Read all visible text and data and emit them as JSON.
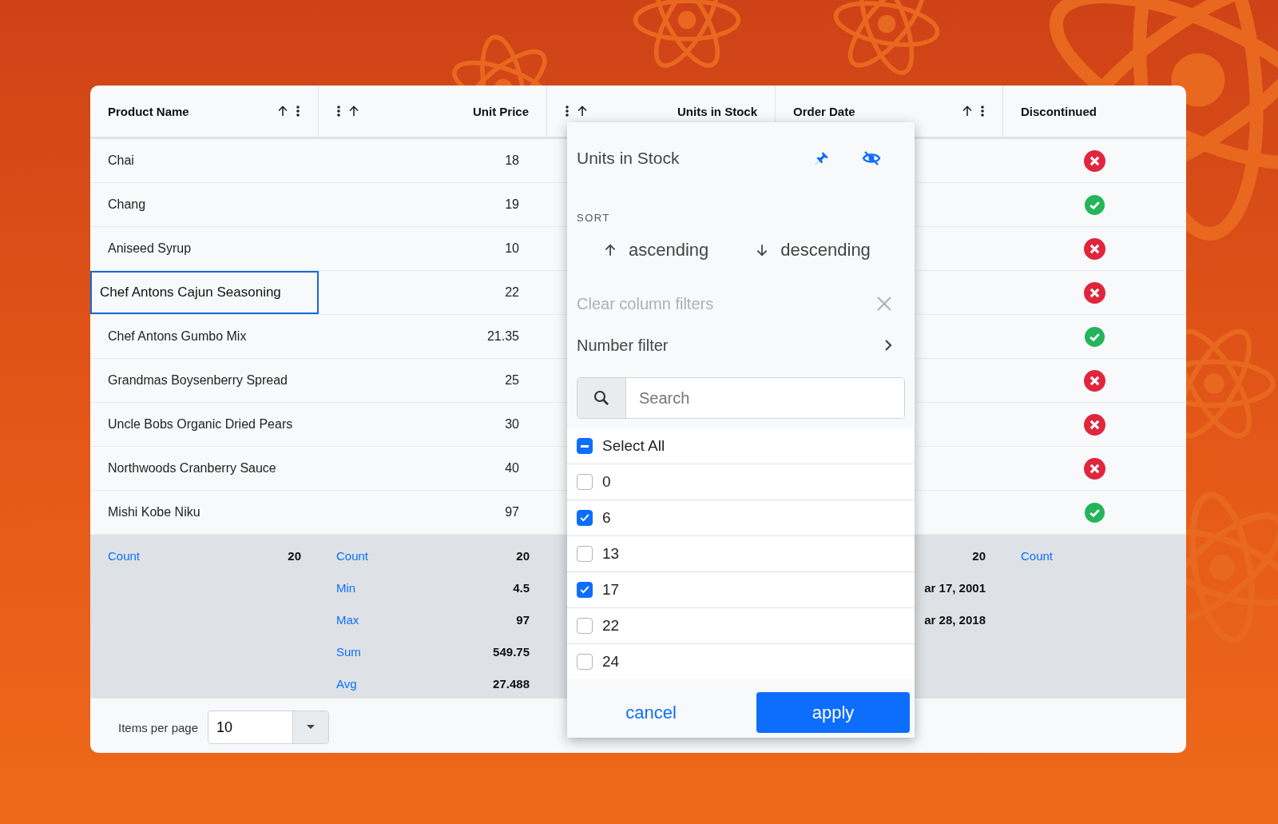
{
  "columns": [
    {
      "title": "Product Name",
      "kind": "text",
      "sorted": true,
      "menu": true
    },
    {
      "title": "Unit Price",
      "kind": "numeric",
      "sorted": true,
      "menu": true
    },
    {
      "title": "Units in Stock",
      "kind": "numeric",
      "sorted": true,
      "menu": true
    },
    {
      "title": "Order Date",
      "kind": "text",
      "sorted": true,
      "menu": true
    },
    {
      "title": "Discontinued",
      "kind": "text",
      "sorted": false,
      "menu": false
    }
  ],
  "rows": [
    {
      "name": "Chai",
      "price": "18",
      "discontinued": true,
      "focused": false
    },
    {
      "name": "Chang",
      "price": "19",
      "discontinued": false,
      "focused": false
    },
    {
      "name": "Aniseed Syrup",
      "price": "10",
      "discontinued": true,
      "focused": false
    },
    {
      "name": "Chef Antons Cajun Seasoning",
      "price": "22",
      "discontinued": true,
      "focused": true
    },
    {
      "name": "Chef Antons Gumbo Mix",
      "price": "21.35",
      "discontinued": false,
      "focused": false
    },
    {
      "name": "Grandmas Boysenberry Spread",
      "price": "25",
      "discontinued": true,
      "focused": false
    },
    {
      "name": "Uncle Bobs Organic Dried Pears",
      "price": "30",
      "discontinued": true,
      "focused": false
    },
    {
      "name": "Northwoods Cranberry Sauce",
      "price": "40",
      "discontinued": true,
      "focused": false
    },
    {
      "name": "Mishi Kobe Niku",
      "price": "97",
      "discontinued": false,
      "focused": false
    }
  ],
  "summary": {
    "product_name": [
      {
        "label": "Count",
        "value": "20"
      }
    ],
    "unit_price": [
      {
        "label": "Count",
        "value": "20"
      },
      {
        "label": "Min",
        "value": "4.5"
      },
      {
        "label": "Max",
        "value": "97"
      },
      {
        "label": "Sum",
        "value": "549.75"
      },
      {
        "label": "Avg",
        "value": "27.488"
      }
    ],
    "order_date": [
      {
        "value": "20"
      },
      {
        "value": "ar 17, 2001"
      },
      {
        "value": "ar 28, 2018"
      }
    ],
    "discontinued": [
      {
        "label": "Count"
      }
    ]
  },
  "pager": {
    "label": "Items per page",
    "value": "10"
  },
  "column_menu": {
    "title": "Units in Stock",
    "sort_label": "SORT",
    "sort_options": [
      {
        "label": "ascending",
        "kind": "up"
      },
      {
        "label": "descending",
        "kind": "down"
      }
    ],
    "clear_filters": {
      "label": "Clear column filters",
      "disabled": true
    },
    "number_filter": "Number filter",
    "search": {
      "placeholder": "Search"
    },
    "select_all": {
      "label": "Select All",
      "indeterminate": true
    },
    "values": [
      {
        "label": "0",
        "checked": false
      },
      {
        "label": "6",
        "checked": true
      },
      {
        "label": "13",
        "checked": false
      },
      {
        "label": "17",
        "checked": true
      },
      {
        "label": "22",
        "checked": false
      },
      {
        "label": "24",
        "checked": false
      }
    ],
    "buttons": [
      {
        "label": "cancel",
        "kind": "secondary"
      },
      {
        "label": "apply",
        "kind": "primary"
      }
    ]
  }
}
